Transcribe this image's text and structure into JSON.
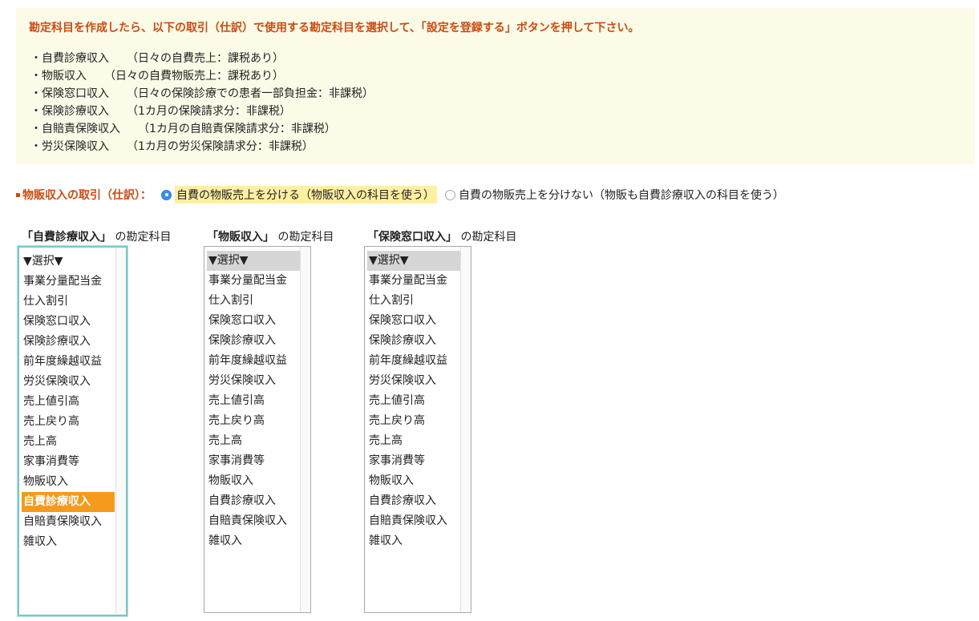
{
  "notice": {
    "title": "勘定科目を作成したら、以下の取引（仕訳）で使用する勘定科目を選択して、「設定を登録する」ボタンを押して下さい。",
    "items": [
      {
        "bullet": "・",
        "name": "自費診療収入",
        "desc": "（日々の自費売上：課税あり）"
      },
      {
        "bullet": "・",
        "name": "物販収入",
        "desc": "（日々の自費物販売上：課税あり）"
      },
      {
        "bullet": "・",
        "name": "保険窓口収入",
        "desc": "（日々の保険診療での患者一部負担金：非課税）"
      },
      {
        "bullet": "・",
        "name": "保険診療収入",
        "desc": "（1カ月の保険請求分：非課税）"
      },
      {
        "bullet": "・",
        "name": "自賠責保険収入",
        "desc": "（1カ月の自賠責保険請求分：非課税）"
      },
      {
        "bullet": "・",
        "name": "労災保険収入",
        "desc": "（1カ月の労災保険請求分：非課税）"
      }
    ]
  },
  "option": {
    "label": "物販収入の取引（仕訳）：",
    "choices": [
      {
        "label": "自費の物販売上を分ける（物販収入の科目を使う）",
        "checked": true
      },
      {
        "label": "自費の物販売上を分けない（物販も自費診療収入の科目を使う）",
        "checked": false
      }
    ]
  },
  "columns": [
    {
      "head_bold": "「自費診療収入」",
      "head_rest": "の勘定科目",
      "selected": "自費診療収入",
      "options": [
        "▼選択▼",
        "事業分量配当金",
        "仕入割引",
        "保険窓口収入",
        "保険診療収入",
        "前年度繰越収益",
        "労災保険収入",
        "売上値引高",
        "売上戻り高",
        "売上高",
        "家事消費等",
        "物販収入",
        "自費診療収入",
        "自賠責保険収入",
        "雑収入"
      ]
    },
    {
      "head_bold": "「物販収入」",
      "head_rest": "の勘定科目",
      "selected": "▼選択▼",
      "options": [
        "▼選択▼",
        "事業分量配当金",
        "仕入割引",
        "保険窓口収入",
        "保険診療収入",
        "前年度繰越収益",
        "労災保険収入",
        "売上値引高",
        "売上戻り高",
        "売上高",
        "家事消費等",
        "物販収入",
        "自費診療収入",
        "自賠責保険収入",
        "雑収入"
      ]
    },
    {
      "head_bold": "「保険窓口収入」",
      "head_rest": "の勘定科目",
      "selected": "▼選択▼",
      "options": [
        "▼選択▼",
        "事業分量配当金",
        "仕入割引",
        "保険窓口収入",
        "保険診療収入",
        "前年度繰越収益",
        "労災保険収入",
        "売上値引高",
        "売上戻り高",
        "売上高",
        "家事消費等",
        "物販収入",
        "自費診療収入",
        "自賠責保険収入",
        "雑収入"
      ]
    }
  ],
  "colors": {
    "accent": "#cc4a10",
    "selected_focused": "#f59a1a",
    "selected_unfocused": "#d6d6d6",
    "highlight": "#fff0a0",
    "notice_bg": "#fcfbe8"
  }
}
